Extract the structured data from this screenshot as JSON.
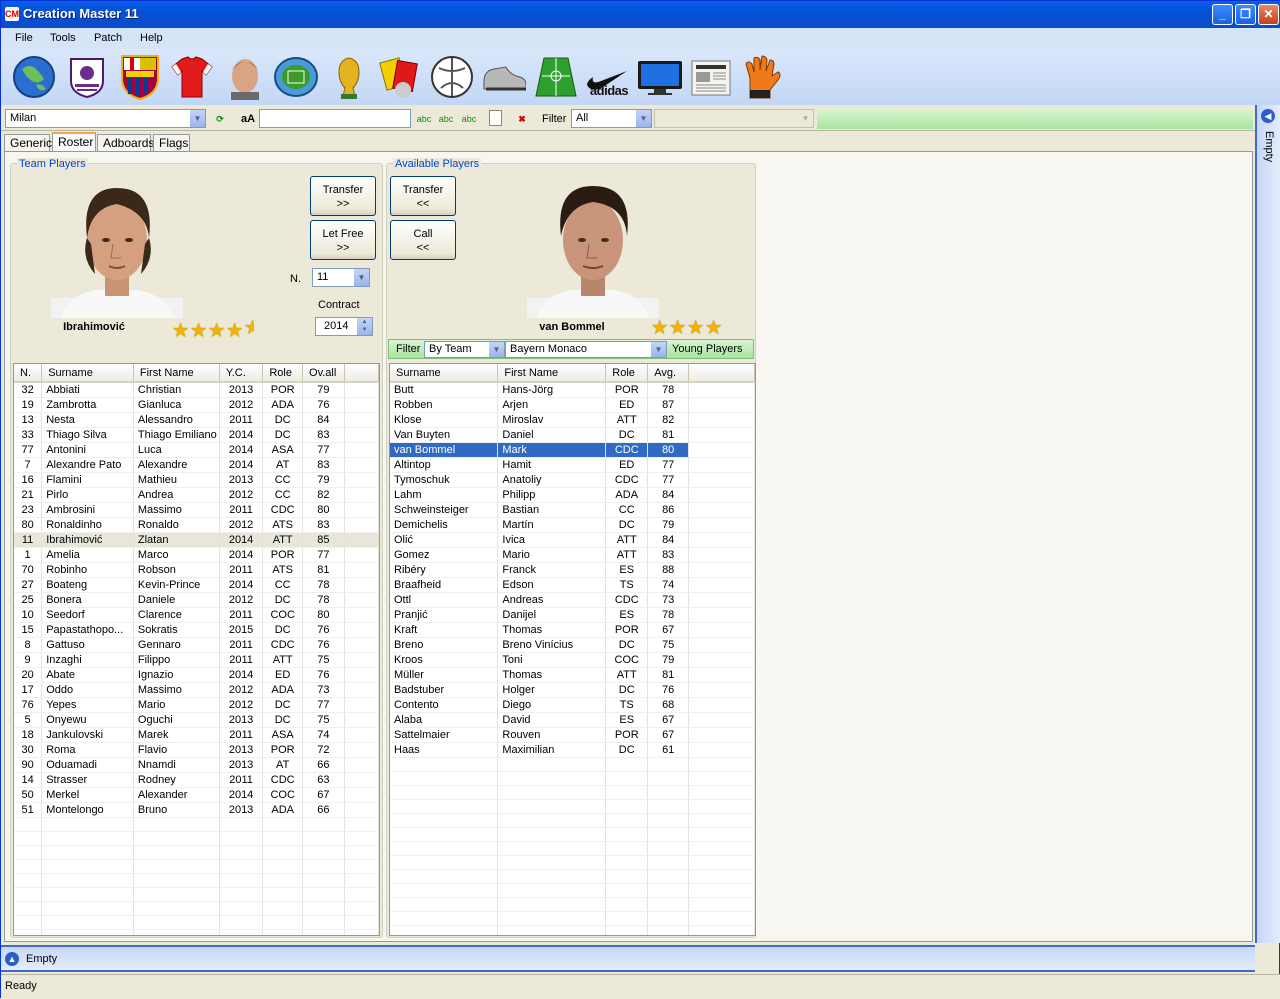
{
  "window": {
    "title": "Creation Master 11"
  },
  "menu": [
    "File",
    "Tools",
    "Patch",
    "Help"
  ],
  "toolbar_icons": [
    "world-icon",
    "premier-league-icon",
    "fcb-crest-icon",
    "jersey-icon",
    "player-face-icon",
    "stadium-icon",
    "world-cup-icon",
    "cards-icon",
    "ball-icon",
    "boot-icon",
    "pitch-icon",
    "nike-icon",
    "adidas-icon",
    "tv-icon",
    "newspaper-icon",
    "glove-icon"
  ],
  "adidas_text": "adidas",
  "filterbar": {
    "team": "Milan",
    "font_label": "aA",
    "filter_label": "Filter",
    "filter_value": "All"
  },
  "tabs": [
    "Generic",
    "Roster",
    "Adboards",
    "Flags"
  ],
  "team": {
    "group_label": "Team Players",
    "player_name": "Ibrahimović",
    "stars": 4.5,
    "transfer_label": "Transfer",
    "transfer_arrow": ">>",
    "letfree_label": "Let Free",
    "letfree_arrow": ">>",
    "number_label": "N.",
    "number_value": "11",
    "contract_label": "Contract",
    "contract_value": "2014",
    "headers": [
      "N.",
      "Surname",
      "First Name",
      "Y.C.",
      "Role",
      "Ov.all"
    ],
    "rows": [
      [
        "32",
        "Abbiati",
        "Christian",
        "2013",
        "POR",
        "79"
      ],
      [
        "19",
        "Zambrotta",
        "Gianluca",
        "2012",
        "ADA",
        "76"
      ],
      [
        "13",
        "Nesta",
        "Alessandro",
        "2011",
        "DC",
        "84"
      ],
      [
        "33",
        "Thiago Silva",
        "Thiago Emiliano",
        "2014",
        "DC",
        "83"
      ],
      [
        "77",
        "Antonini",
        "Luca",
        "2014",
        "ASA",
        "77"
      ],
      [
        "7",
        "Alexandre Pato",
        "Alexandre",
        "2014",
        "AT",
        "83"
      ],
      [
        "16",
        "Flamini",
        "Mathieu",
        "2013",
        "CC",
        "79"
      ],
      [
        "21",
        "Pirlo",
        "Andrea",
        "2012",
        "CC",
        "82"
      ],
      [
        "23",
        "Ambrosini",
        "Massimo",
        "2011",
        "CDC",
        "80"
      ],
      [
        "80",
        "Ronaldinho",
        "Ronaldo",
        "2012",
        "ATS",
        "83"
      ],
      [
        "11",
        "Ibrahimović",
        "Zlatan",
        "2014",
        "ATT",
        "85"
      ],
      [
        "1",
        "Amelia",
        "Marco",
        "2014",
        "POR",
        "77"
      ],
      [
        "70",
        "Robinho",
        "Robson",
        "2011",
        "ATS",
        "81"
      ],
      [
        "27",
        "Boateng",
        "Kevin-Prince",
        "2014",
        "CC",
        "78"
      ],
      [
        "25",
        "Bonera",
        "Daniele",
        "2012",
        "DC",
        "78"
      ],
      [
        "10",
        "Seedorf",
        "Clarence",
        "2011",
        "COC",
        "80"
      ],
      [
        "15",
        "Papastathopo...",
        "Sokratis",
        "2015",
        "DC",
        "76"
      ],
      [
        "8",
        "Gattuso",
        "Gennaro",
        "2011",
        "CDC",
        "76"
      ],
      [
        "9",
        "Inzaghi",
        "Filippo",
        "2011",
        "ATT",
        "75"
      ],
      [
        "20",
        "Abate",
        "Ignazio",
        "2014",
        "ED",
        "76"
      ],
      [
        "17",
        "Oddo",
        "Massimo",
        "2012",
        "ADA",
        "73"
      ],
      [
        "76",
        "Yepes",
        "Mario",
        "2012",
        "DC",
        "77"
      ],
      [
        "5",
        "Onyewu",
        "Oguchi",
        "2013",
        "DC",
        "75"
      ],
      [
        "18",
        "Jankulovski",
        "Marek",
        "2011",
        "ASA",
        "74"
      ],
      [
        "30",
        "Roma",
        "Flavio",
        "2013",
        "POR",
        "72"
      ],
      [
        "90",
        "Oduamadi",
        "Nnamdi",
        "2013",
        "AT",
        "66"
      ],
      [
        "14",
        "Strasser",
        "Rodney",
        "2011",
        "CDC",
        "63"
      ],
      [
        "50",
        "Merkel",
        "Alexander",
        "2014",
        "COC",
        "67"
      ],
      [
        "51",
        "Montelongo",
        "Bruno",
        "2013",
        "ADA",
        "66"
      ]
    ],
    "highlighted_row": 10
  },
  "available": {
    "group_label": "Available Players",
    "player_name": "van Bommel",
    "stars": 4,
    "transfer_label": "Transfer",
    "transfer_arrow": "<<",
    "call_label": "Call",
    "call_arrow": "<<",
    "filter_label": "Filter",
    "filter_by": "By Team",
    "filter_team": "Bayern Monaco",
    "young_label": "Young Players",
    "headers": [
      "Surname",
      "First Name",
      "Role",
      "Avg."
    ],
    "rows": [
      [
        "Butt",
        "Hans-Jörg",
        "POR",
        "78"
      ],
      [
        "Robben",
        "Arjen",
        "ED",
        "87"
      ],
      [
        "Klose",
        "Miroslav",
        "ATT",
        "82"
      ],
      [
        "Van Buyten",
        "Daniel",
        "DC",
        "81"
      ],
      [
        "van Bommel",
        "Mark",
        "CDC",
        "80"
      ],
      [
        "Altintop",
        "Hamit",
        "ED",
        "77"
      ],
      [
        "Tymoschuk",
        "Anatoliy",
        "CDC",
        "77"
      ],
      [
        "Lahm",
        "Philipp",
        "ADA",
        "84"
      ],
      [
        "Schweinsteiger",
        "Bastian",
        "CC",
        "86"
      ],
      [
        "Demichelis",
        "Martín",
        "DC",
        "79"
      ],
      [
        "Olić",
        "Ivica",
        "ATT",
        "84"
      ],
      [
        "Gomez",
        "Mario",
        "ATT",
        "83"
      ],
      [
        "Ribéry",
        "Franck",
        "ES",
        "88"
      ],
      [
        "Braafheid",
        "Edson",
        "TS",
        "74"
      ],
      [
        "Ottl",
        "Andreas",
        "CDC",
        "73"
      ],
      [
        "Pranjić",
        "Danijel",
        "ES",
        "78"
      ],
      [
        "Kraft",
        "Thomas",
        "POR",
        "67"
      ],
      [
        "Breno",
        "Breno Vinícius",
        "DC",
        "75"
      ],
      [
        "Kroos",
        "Toni",
        "COC",
        "79"
      ],
      [
        "Müller",
        "Thomas",
        "ATT",
        "81"
      ],
      [
        "Badstuber",
        "Holger",
        "DC",
        "76"
      ],
      [
        "Contento",
        "Diego",
        "TS",
        "68"
      ],
      [
        "Alaba",
        "David",
        "ES",
        "67"
      ],
      [
        "Sattelmaier",
        "Rouven",
        "POR",
        "67"
      ],
      [
        "Haas",
        "Maximilian",
        "DC",
        "61"
      ]
    ],
    "selected_row": 4
  },
  "right_dock": {
    "label": "Empty"
  },
  "bottom_dock": {
    "label": "Empty"
  },
  "status": {
    "text": "Ready"
  },
  "colors": {
    "accent": "#0451d6",
    "selection": "#316ac5",
    "group_label": "#0046d5",
    "filter_green": "#a8e4a0"
  }
}
